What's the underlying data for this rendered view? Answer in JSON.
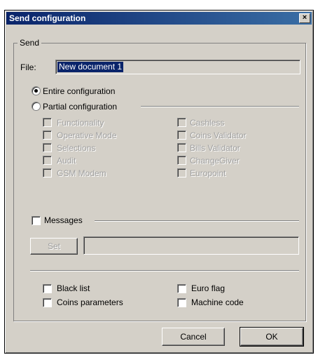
{
  "window": {
    "title": "Send configuration",
    "close": "×"
  },
  "send_group": {
    "label": "Send"
  },
  "file": {
    "label": "File:",
    "value": "New document 1"
  },
  "scope": {
    "entire": "Entire configuration",
    "partial": "Partial configuration",
    "selected": "entire"
  },
  "partial_items": {
    "left": [
      "Functionality",
      "Operative Mode",
      "Selections",
      "Audit",
      "GSM Modem"
    ],
    "right": [
      "Cashless",
      "Coins Validator",
      "Bills Validator",
      "ChangeGiver",
      "Europoint"
    ]
  },
  "messages": {
    "label": "Messages",
    "set_button": "Set",
    "value": ""
  },
  "options": {
    "black_list": "Black list",
    "coins_parameters": "Coins parameters",
    "euro_flag": "Euro flag",
    "machine_code": "Machine code"
  },
  "buttons": {
    "cancel": "Cancel",
    "ok": "OK"
  },
  "colors": {
    "title_bar": "#0a246a",
    "dialog_bg": "#d4d0c8",
    "selection": "#0a246a"
  }
}
